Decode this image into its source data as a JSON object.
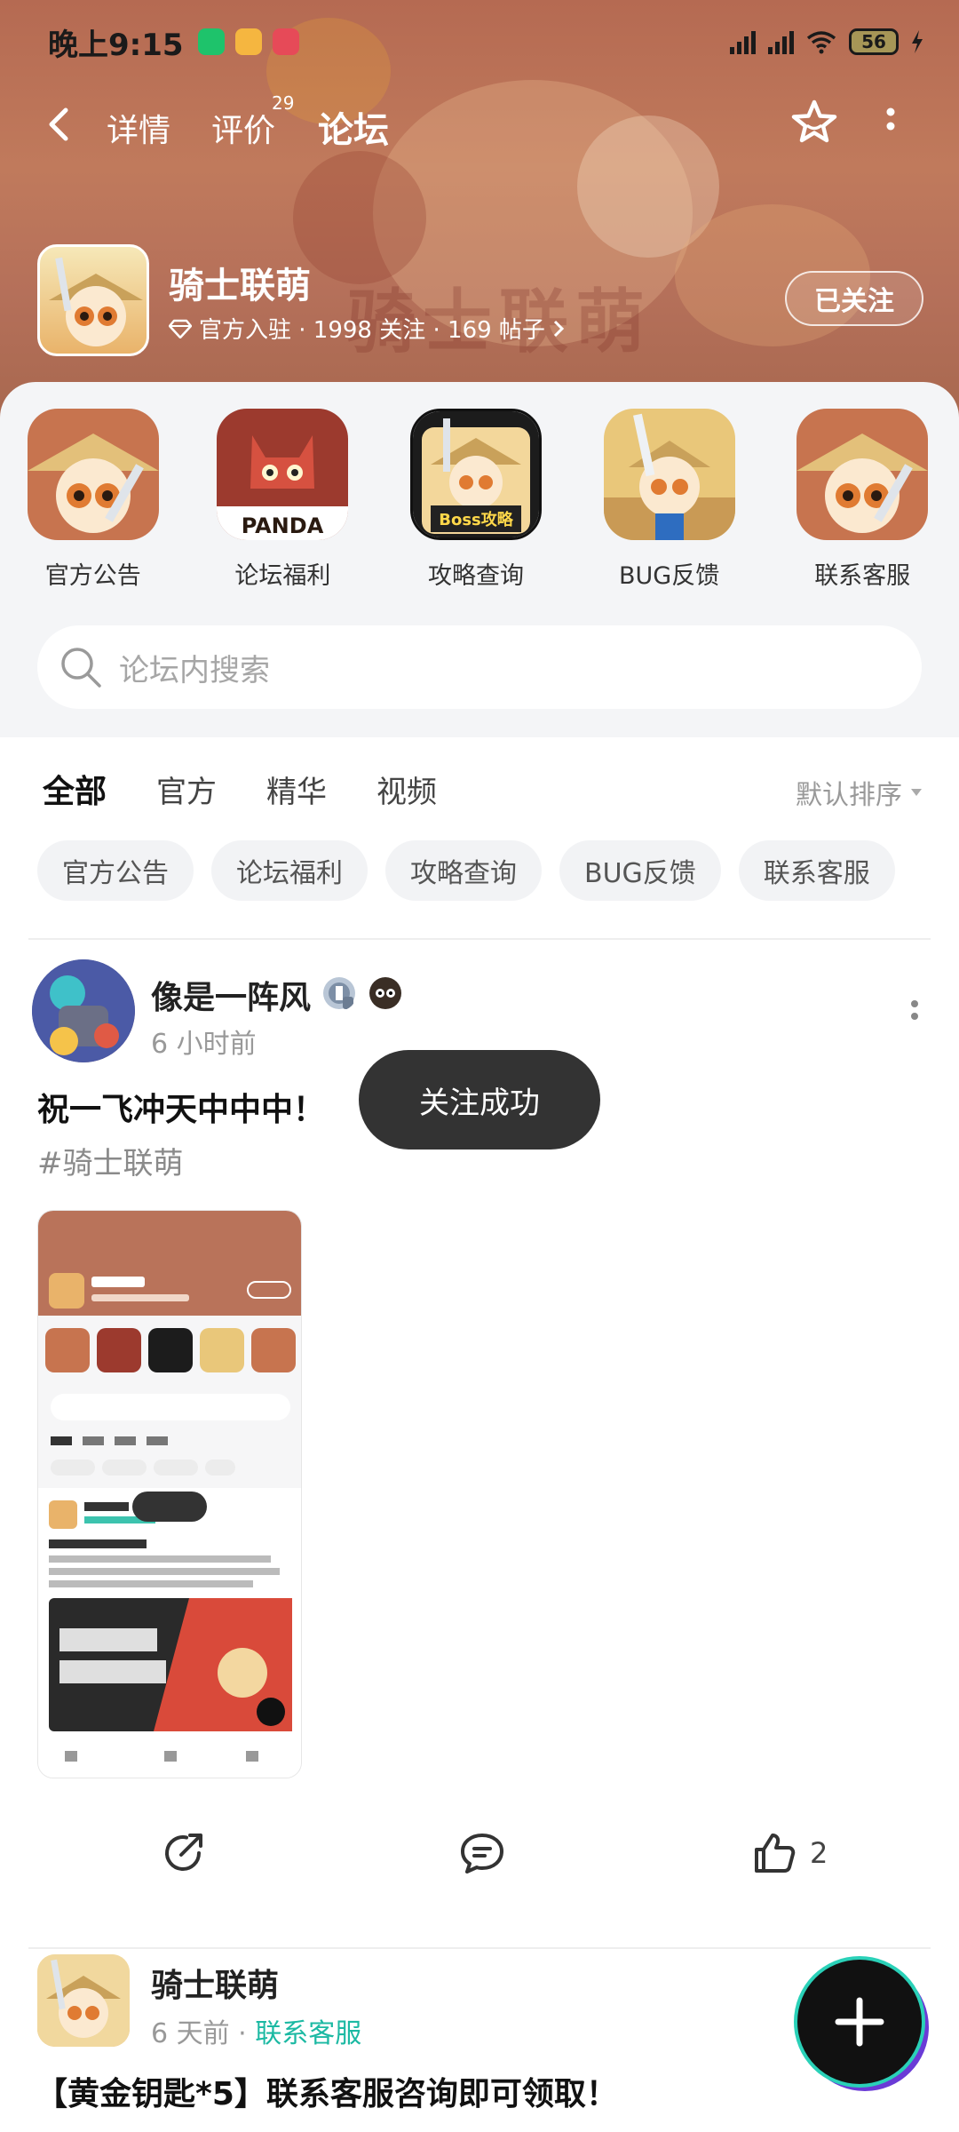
{
  "status_bar": {
    "time": "晚上9:15",
    "battery": "56"
  },
  "nav": {
    "tabs": [
      {
        "label": "详情"
      },
      {
        "label": "评价",
        "badge": "29"
      },
      {
        "label": "论坛"
      }
    ]
  },
  "forum": {
    "name": "骑士联萌",
    "meta": "官方入驻 · 1998 关注 · 169 帖子",
    "follow_label": "已关注",
    "banner_watermark": "骑士联萌"
  },
  "quick_links": [
    {
      "label": "官方公告"
    },
    {
      "label": "论坛福利",
      "badge_text": "PANDA"
    },
    {
      "label": "攻略查询",
      "badge_text": "Boss攻略"
    },
    {
      "label": "BUG反馈"
    },
    {
      "label": "联系客服"
    }
  ],
  "search": {
    "placeholder": "论坛内搜索"
  },
  "filter_tabs": [
    {
      "label": "全部"
    },
    {
      "label": "官方"
    },
    {
      "label": "精华"
    },
    {
      "label": "视频"
    }
  ],
  "sort_label": "默认排序",
  "chips": [
    "官方公告",
    "论坛福利",
    "攻略查询",
    "BUG反馈",
    "联系客服"
  ],
  "posts": [
    {
      "user": "像是一阵风",
      "time": "6 小时前",
      "title": "祝一飞冲天中中中！",
      "tag": "#骑士联萌",
      "likes": "2"
    },
    {
      "user": "骑士联萌",
      "time": "6 天前",
      "category": "联系客服",
      "title": "【黄金钥匙*5】联系客服咨询即可领取！"
    }
  ],
  "toast": "关注成功",
  "colors": {
    "accent": "#25d0b6",
    "banner": "#b9735a",
    "toast_bg": "#333333"
  }
}
